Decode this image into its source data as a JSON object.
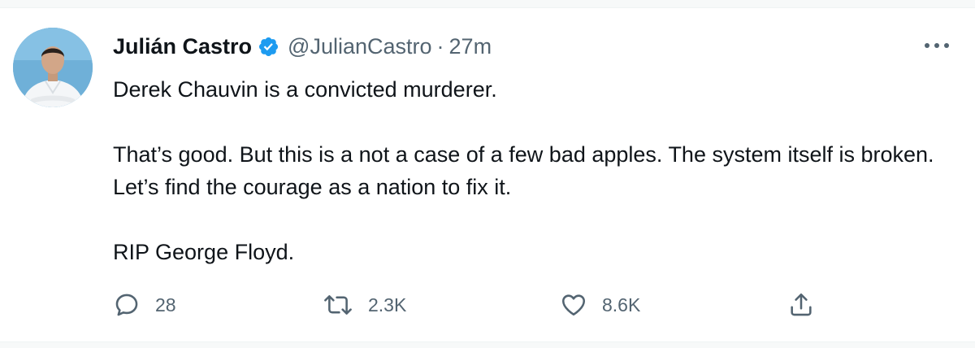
{
  "author": {
    "name": "Julián Castro",
    "handle": "@JulianCastro",
    "separator": "·",
    "time": "27m",
    "verified": true
  },
  "tweet": {
    "paragraphs": [
      "Derek Chauvin is a convicted murderer.",
      "That’s good. But this is a not a case of a few bad apples. The system itself is broken. Let’s find the courage as a nation to fix it.",
      "RIP George Floyd."
    ]
  },
  "actions": {
    "reply": {
      "count": "28",
      "icon": "reply-icon"
    },
    "retweet": {
      "count": "2.3K",
      "icon": "retweet-icon"
    },
    "like": {
      "count": "8.6K",
      "icon": "heart-icon"
    },
    "share": {
      "icon": "share-icon"
    }
  },
  "menu": {
    "icon": "more-icon"
  },
  "colors": {
    "text": "#0f1419",
    "secondary": "#536471",
    "verified": "#1d9bf0",
    "avatar_bg": "#6fb0d8"
  }
}
